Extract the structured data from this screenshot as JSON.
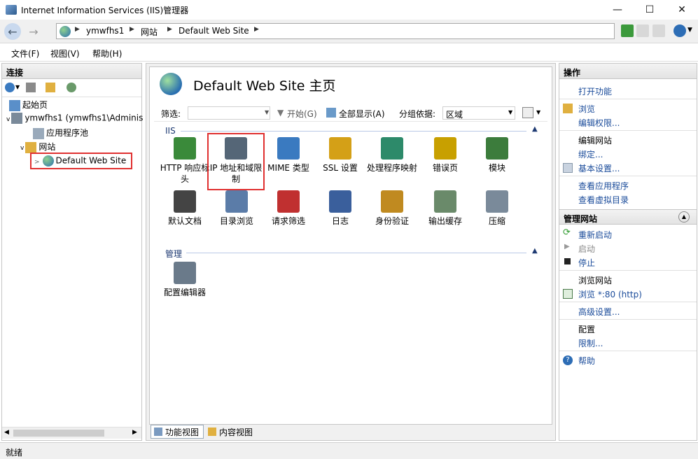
{
  "window": {
    "title": "Internet Information Services (IIS)管理器",
    "controls": {
      "minimize": "—",
      "maximize": "☐",
      "close": "✕"
    }
  },
  "address": {
    "crumbs": [
      "ymwfhs1",
      "网站",
      "Default Web Site"
    ]
  },
  "menu": [
    "文件(F)",
    "视图(V)",
    "帮助(H)"
  ],
  "connections": {
    "header": "连接",
    "tree": [
      {
        "label": "起始页"
      },
      {
        "label": "ymwfhs1 (ymwfhs1\\Adminis"
      },
      {
        "label": "应用程序池"
      },
      {
        "label": "网站"
      },
      {
        "label": "Default Web Site"
      }
    ]
  },
  "center": {
    "title": "Default Web Site 主页",
    "filter": {
      "label": "筛选:",
      "start": "开始(G)",
      "show_all": "全部显示(A)",
      "group_by": "分组依据:",
      "group_value": "区域"
    },
    "sections": [
      {
        "name": "IIS",
        "features": [
          {
            "label": "HTTP 响应标头",
            "icon": "http-headers-icon",
            "color": "#3a8a3a"
          },
          {
            "label": "IP 地址和域限制",
            "icon": "ip-restrictions-icon",
            "color": "#556677"
          },
          {
            "label": "MIME 类型",
            "icon": "mime-types-icon",
            "color": "#3a7ac0"
          },
          {
            "label": "SSL 设置",
            "icon": "ssl-lock-icon",
            "color": "#d4a017"
          },
          {
            "label": "处理程序映射",
            "icon": "handler-mappings-icon",
            "color": "#2d8a6a"
          },
          {
            "label": "错误页",
            "icon": "error-pages-icon",
            "color": "#c8a000"
          },
          {
            "label": "模块",
            "icon": "modules-icon",
            "color": "#3c7c3c"
          },
          {
            "label": "默认文档",
            "icon": "default-document-icon",
            "color": "#444444"
          },
          {
            "label": "目录浏览",
            "icon": "directory-browsing-icon",
            "color": "#5b7ca8"
          },
          {
            "label": "请求筛选",
            "icon": "request-filtering-icon",
            "color": "#c03030"
          },
          {
            "label": "日志",
            "icon": "logging-icon",
            "color": "#3a5f9c"
          },
          {
            "label": "身份验证",
            "icon": "authentication-icon",
            "color": "#c08a20"
          },
          {
            "label": "输出缓存",
            "icon": "output-caching-icon",
            "color": "#6a8a6a"
          },
          {
            "label": "压缩",
            "icon": "compression-icon",
            "color": "#7a8a9a"
          }
        ]
      },
      {
        "name": "管理",
        "features": [
          {
            "label": "配置编辑器",
            "icon": "configuration-editor-icon",
            "color": "#6a7a8a"
          }
        ]
      }
    ],
    "tabs": [
      "功能视图",
      "内容视图"
    ]
  },
  "actions": {
    "header": "操作",
    "open_feature": "打开功能",
    "browse": "浏览",
    "edit_permissions": "编辑权限...",
    "edit_site_head": "编辑网站",
    "bindings": "绑定...",
    "basic_settings": "基本设置...",
    "view_apps": "查看应用程序",
    "view_vdirs": "查看虚拟目录",
    "manage_site_head": "管理网站",
    "restart": "重新启动",
    "start": "启动",
    "stop": "停止",
    "browse_site_head": "浏览网站",
    "browse_80": "浏览 *:80 (http)",
    "advanced_settings": "高级设置...",
    "config_head": "配置",
    "limits": "限制...",
    "help": "帮助"
  },
  "status": "就绪"
}
